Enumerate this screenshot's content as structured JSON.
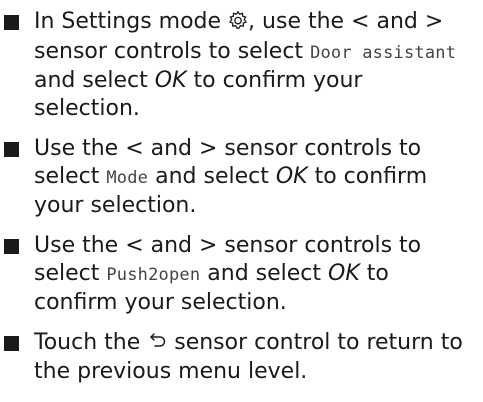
{
  "steps": [
    {
      "p1": "In Settings mode ",
      "icon": "gear-icon",
      "p2": ", use the < and > sensor controls to select ",
      "display": "Door assistant",
      "p3": " and select ",
      "italic": "OK",
      "p4": " to confirm your selection."
    },
    {
      "p1": "Use the < and > sensor controls to select ",
      "display": "Mode",
      "p2": " and select ",
      "italic": "OK",
      "p3": " to confirm your selection."
    },
    {
      "p1": "Use the < and > sensor controls to select ",
      "display": "Push2open",
      "p2": " and select ",
      "italic": "OK",
      "p3": " to confirm your selection."
    },
    {
      "p1": "Touch the ",
      "icon": "back-arrow-icon",
      "p2": " sensor control to return to the previous menu level."
    }
  ]
}
